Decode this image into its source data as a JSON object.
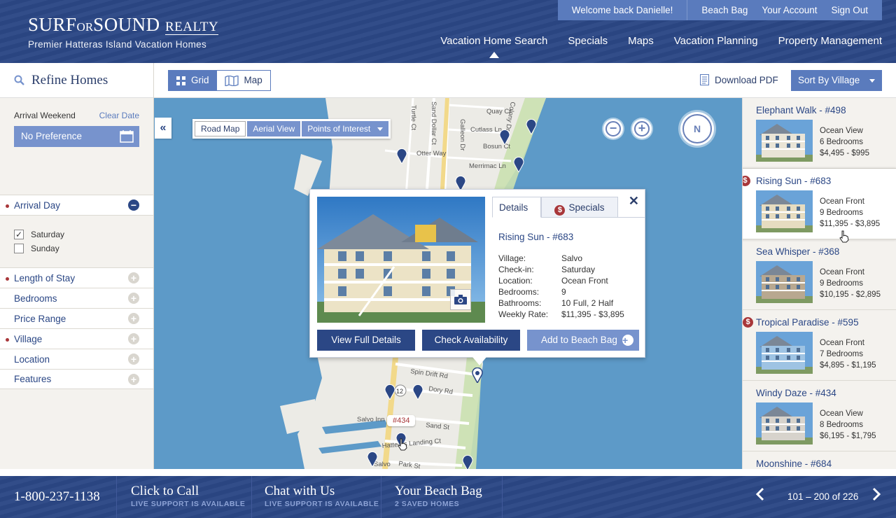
{
  "brand": {
    "name_part1": "SURF",
    "name_or": "OR",
    "name_part2": "SOUND",
    "name_realty": "REALTY",
    "tagline": "Premier Hatteras Island Vacation Homes"
  },
  "utility_nav": {
    "welcome": "Welcome back Danielle!",
    "beach_bag": "Beach Bag",
    "account": "Your Account",
    "sign_out": "Sign Out"
  },
  "main_nav": [
    "Vacation Home Search",
    "Specials",
    "Maps",
    "Vacation Planning",
    "Property Management"
  ],
  "toolbar": {
    "grid_label": "Grid",
    "map_label": "Map",
    "download_label": "Download PDF",
    "sort_label": "Sort By Village"
  },
  "sidebar": {
    "title": "Refine Homes",
    "arrival_weekend_label": "Arrival Weekend",
    "clear_date": "Clear Date",
    "date_value": "No Preference",
    "arrival_day": "Arrival Day",
    "day_options": [
      {
        "label": "Saturday",
        "checked": true
      },
      {
        "label": "Sunday",
        "checked": false
      }
    ],
    "facets": [
      {
        "label": "Length of Stay",
        "dot": true
      },
      {
        "label": "Bedrooms",
        "dot": false
      },
      {
        "label": "Price Range",
        "dot": false
      },
      {
        "label": "Village",
        "dot": true
      },
      {
        "label": "Location",
        "dot": false
      },
      {
        "label": "Features",
        "dot": false
      }
    ]
  },
  "map": {
    "type_buttons": [
      "Road Map",
      "Aerial View",
      "Points of Interest"
    ],
    "compass_label": "N",
    "street_labels": [
      "Quay Ct",
      "Cutlass Ln",
      "Bosun Ct",
      "Otter Way",
      "Merrimac Ln",
      "Spin Drift Rd",
      "Dory Rd",
      "Salvo Inn",
      "Sand St",
      "Hatteras Landing Ct",
      "Salvo",
      "Park St",
      "Sand Dollar Ct",
      "Galleon Dr",
      "Colony Dr",
      "Turtle Ct"
    ],
    "route_shield": "12",
    "pin_label": "#434"
  },
  "popup": {
    "tab_details": "Details",
    "tab_specials": "Specials",
    "title": "Rising Sun - #683",
    "facts": [
      {
        "label": "Village:",
        "value": "Salvo"
      },
      {
        "label": "Check-in:",
        "value": "Saturday"
      },
      {
        "label": "Location:",
        "value": "Ocean Front"
      },
      {
        "label": "Bedrooms:",
        "value": "9"
      },
      {
        "label": "Bathrooms:",
        "value": "10 Full, 2 Half"
      },
      {
        "label": "Weekly Rate:",
        "value": "$11,395 - $3,895"
      }
    ],
    "btn_details": "View Full Details",
    "btn_availability": "Check Availability",
    "btn_bag": "Add to Beach Bag"
  },
  "listings": [
    {
      "title": "Elephant Walk - #498",
      "special": false,
      "active": false,
      "location": "Ocean View",
      "bedrooms": "6 Bedrooms",
      "rate": "$4,495 - $995",
      "house_color": "#e9e4d6"
    },
    {
      "title": "Rising Sun - #683",
      "special": true,
      "active": true,
      "location": "Ocean Front",
      "bedrooms": "9 Bedrooms",
      "rate": "$11,395 - $3,895",
      "house_color": "#e6dcc0"
    },
    {
      "title": "Sea Whisper - #368",
      "special": false,
      "active": false,
      "location": "Ocean Front",
      "bedrooms": "9 Bedrooms",
      "rate": "$10,195 - $2,895",
      "house_color": "#b8a890"
    },
    {
      "title": "Tropical Paradise - #595",
      "special": true,
      "active": false,
      "location": "Ocean Front",
      "bedrooms": "7 Bedrooms",
      "rate": "$4,895 - $1,195",
      "house_color": "#9ec3e3"
    },
    {
      "title": "Windy Daze - #434",
      "special": false,
      "active": false,
      "location": "Ocean View",
      "bedrooms": "8 Bedrooms",
      "rate": "$6,195 - $1,795",
      "house_color": "#d7d3cc"
    },
    {
      "title": "Moonshine - #684",
      "special": false,
      "active": false,
      "location": "",
      "bedrooms": "",
      "rate": "",
      "house_color": "#cfc8bb"
    }
  ],
  "footer": {
    "phone": "1-800-237-1138",
    "call_title": "Click to Call",
    "call_sub": "LIVE SUPPORT IS AVAILABLE",
    "chat_title": "Chat with Us",
    "chat_sub": "LIVE SUPPORT IS AVAILABLE",
    "bag_title": "Your Beach Bag",
    "bag_sub": "2 SAVED HOMES",
    "pager_text": "101 – 200 of 226"
  },
  "colors": {
    "navy": "#2b4785",
    "accent": "#5a7bbd",
    "button_light": "#7793cd",
    "water": "#5d9ac8",
    "special_red": "#a8373a"
  }
}
